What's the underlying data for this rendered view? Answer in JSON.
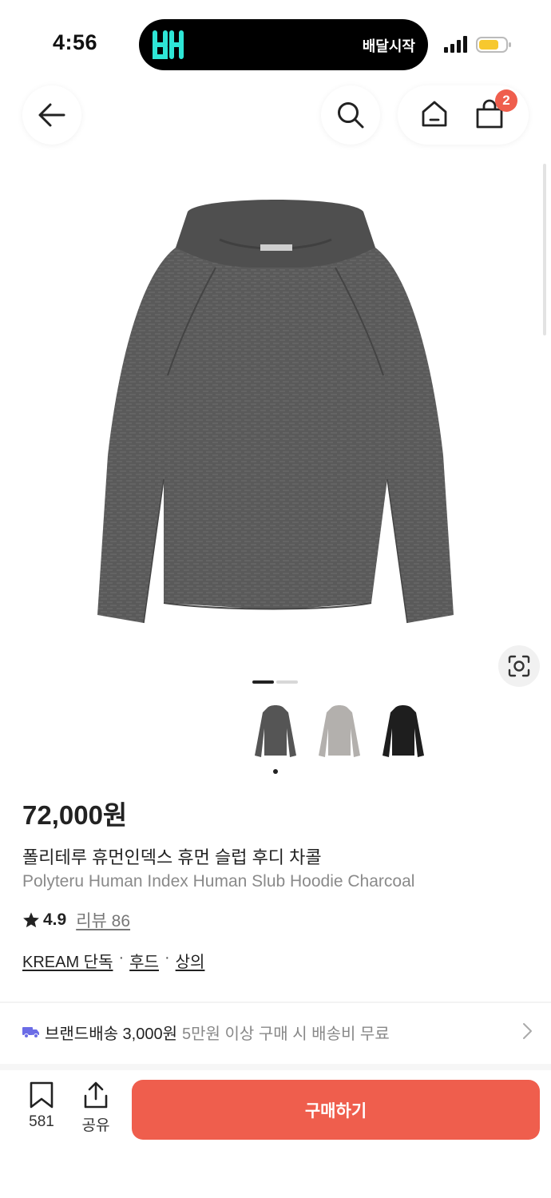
{
  "status_bar": {
    "time": "4:56",
    "island_text": "배달시작",
    "island_logo_icon": "baemin-logo",
    "accent": "#2ee6d6",
    "battery_color": "#f7c82e"
  },
  "nav": {
    "cart_count": "2",
    "icons": [
      "back-arrow-icon",
      "search-icon",
      "home-icon",
      "shopping-bag-icon"
    ]
  },
  "gallery": {
    "current_image": 1,
    "total_images": 2,
    "variants": [
      {
        "color_name": "charcoal",
        "color": "#555555",
        "selected": true
      },
      {
        "color_name": "light-grey",
        "color": "#b3b0ad",
        "selected": false
      },
      {
        "color_name": "black",
        "color": "#1e1e1e",
        "selected": false
      }
    ]
  },
  "product": {
    "price": "72,000원",
    "name_ko": "폴리테루 휴먼인덱스 휴먼 슬럽 후디 차콜",
    "name_en": "Polyteru Human Index Human Slub Hoodie Charcoal",
    "rating": "4.9",
    "review_label": "리뷰 86",
    "tags": [
      "KREAM 단독",
      "후드",
      "상의"
    ],
    "tag_separator": "·"
  },
  "shipping": {
    "label": "브랜드배송 3,000원",
    "note": "5만원 이상 구매 시 배송비 무료",
    "truck_color": "#6b6ce6"
  },
  "bottom_bar": {
    "bookmark_count": "581",
    "share_label": "공유",
    "buy_label": "구매하기",
    "buy_color": "#ef5e4d"
  }
}
